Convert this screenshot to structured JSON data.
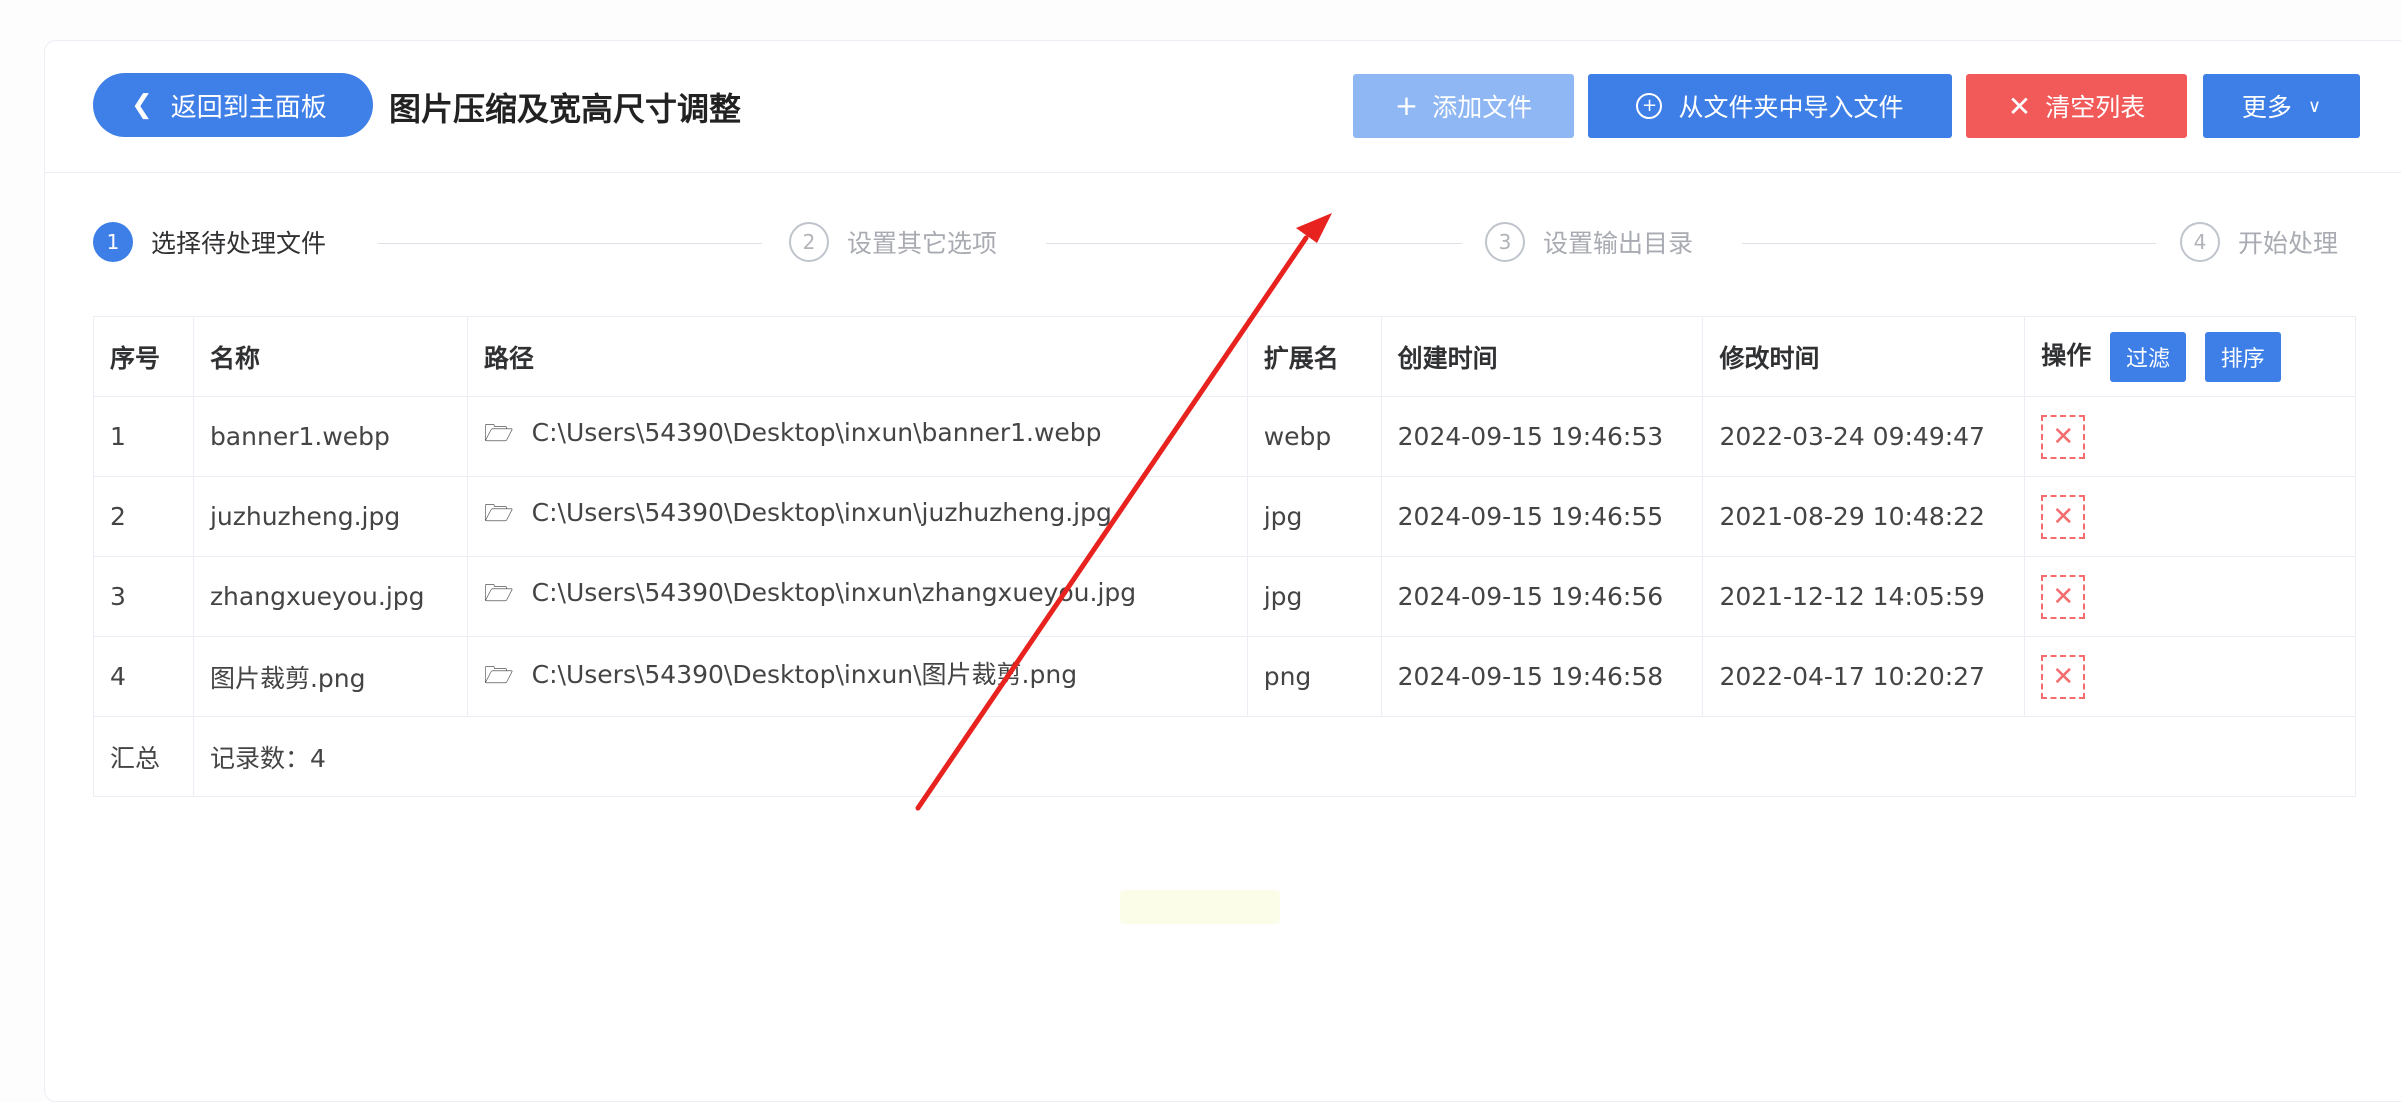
{
  "header": {
    "back_label": "返回到主面板",
    "title": "图片压缩及宽高尺寸调整",
    "add_file": "添加文件",
    "import_folder": "从文件夹中导入文件",
    "clear_list": "清空列表",
    "more": "更多"
  },
  "steps": [
    {
      "num": "1",
      "label": "选择待处理文件",
      "active": true
    },
    {
      "num": "2",
      "label": "设置其它选项",
      "active": false
    },
    {
      "num": "3",
      "label": "设置输出目录",
      "active": false
    },
    {
      "num": "4",
      "label": "开始处理",
      "active": false
    }
  ],
  "table": {
    "headers": {
      "index": "序号",
      "name": "名称",
      "path": "路径",
      "ext": "扩展名",
      "created": "创建时间",
      "modified": "修改时间",
      "action": "操作",
      "filter": "过滤",
      "sort": "排序"
    },
    "rows": [
      {
        "index": "1",
        "name": "banner1.webp",
        "path": "C:\\Users\\54390\\Desktop\\inxun\\banner1.webp",
        "ext": "webp",
        "created": "2024-09-15 19:46:53",
        "modified": "2022-03-24 09:49:47"
      },
      {
        "index": "2",
        "name": "juzhuzheng.jpg",
        "path": "C:\\Users\\54390\\Desktop\\inxun\\juzhuzheng.jpg",
        "ext": "jpg",
        "created": "2024-09-15 19:46:55",
        "modified": "2021-08-29 10:48:22"
      },
      {
        "index": "3",
        "name": "zhangxueyou.jpg",
        "path": "C:\\Users\\54390\\Desktop\\inxun\\zhangxueyou.jpg",
        "ext": "jpg",
        "created": "2024-09-15 19:46:56",
        "modified": "2021-12-12 14:05:59"
      },
      {
        "index": "4",
        "name": "图片裁剪.png",
        "path": "C:\\Users\\54390\\Desktop\\inxun\\图片裁剪.png",
        "ext": "png",
        "created": "2024-09-15 19:46:58",
        "modified": "2022-04-17 10:20:27"
      }
    ],
    "summary_label": "汇总",
    "summary_value": "记录数：4"
  },
  "colors": {
    "primary": "#3d7fe6",
    "primary_light": "#8fb7f3",
    "danger": "#f25a5a",
    "annotation_arrow": "#e8231f"
  },
  "icons": {
    "back": "chevron-left-icon",
    "add": "plus-icon",
    "import": "circle-plus-icon",
    "clear": "close-icon",
    "more": "chevron-down-icon",
    "path": "folder-open-icon",
    "delete": "delete-x-icon"
  }
}
